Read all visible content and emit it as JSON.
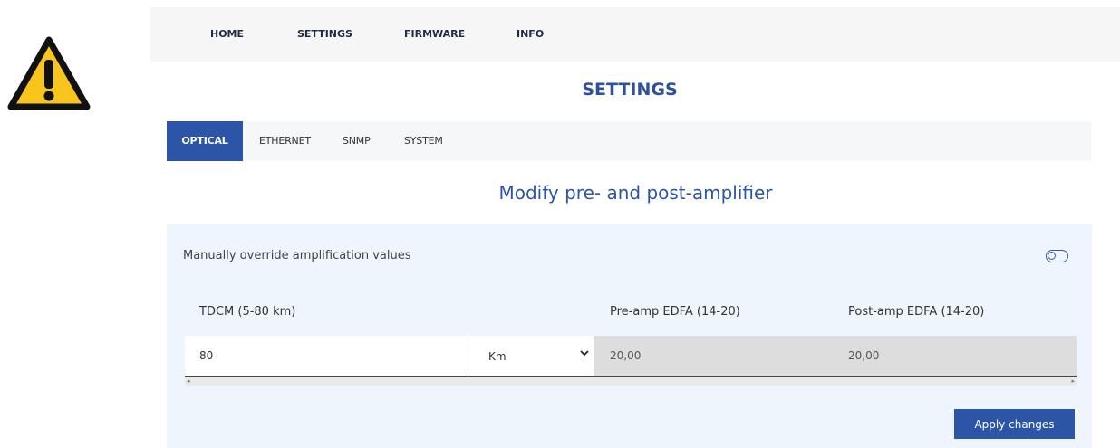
{
  "nav": {
    "items": [
      "HOME",
      "SETTINGS",
      "FIRMWARE",
      "INFO"
    ]
  },
  "page_title": "SETTINGS",
  "tabs": [
    {
      "label": "OPTICAL",
      "active": true
    },
    {
      "label": "ETHERNET",
      "active": false
    },
    {
      "label": "SNMP",
      "active": false
    },
    {
      "label": "SYSTEM",
      "active": false
    }
  ],
  "subtitle": "Modify pre- and post-amplifier",
  "panel": {
    "override_label": "Manually override amplification values",
    "override_enabled": false,
    "columns": {
      "tdcm": "TDCM (5-80 km)",
      "pre_amp": "Pre-amp EDFA (14-20)",
      "post_amp": "Post-amp EDFA (14-20)"
    },
    "tdcm_value": "80",
    "unit": "Km",
    "pre_amp_value": "20,00",
    "post_amp_value": "20,00",
    "apply_label": "Apply changes"
  },
  "colors": {
    "accent": "#2c55a8",
    "warning": "#f7c51c"
  },
  "icons": [
    "warning-icon",
    "toggle-icon",
    "chevron-down-icon",
    "scroll-left-icon",
    "scroll-right-icon"
  ]
}
